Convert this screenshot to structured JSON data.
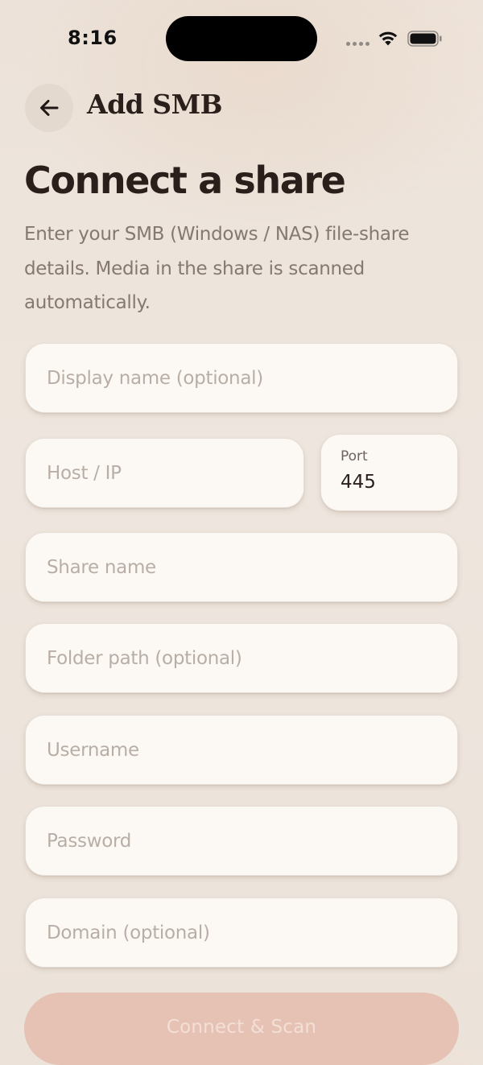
{
  "status_bar": {
    "time": "8:16",
    "icons": [
      "signal-dots-icon",
      "wifi-icon",
      "battery-icon"
    ]
  },
  "header": {
    "back_icon": "arrow-left-icon",
    "title": "Add SMB"
  },
  "main": {
    "title": "Connect a share",
    "description": "Enter your SMB (Windows / NAS) file-share details. Media in the share is scanned automatically."
  },
  "form": {
    "display_name": {
      "placeholder": "Display name (optional)",
      "value": ""
    },
    "host": {
      "placeholder": "Host / IP",
      "value": ""
    },
    "port": {
      "label": "Port",
      "value": "445"
    },
    "share_name": {
      "placeholder": "Share name",
      "value": ""
    },
    "folder_path": {
      "placeholder": "Folder path (optional)",
      "value": ""
    },
    "username": {
      "placeholder": "Username",
      "value": ""
    },
    "password": {
      "placeholder": "Password",
      "value": ""
    },
    "domain": {
      "placeholder": "Domain (optional)",
      "value": ""
    }
  },
  "actions": {
    "connect_label": "Connect & Scan"
  },
  "colors": {
    "background": "#ede4dc",
    "field_background": "#fcf9f5",
    "accent_disabled": "#e6c2b4",
    "title_text": "#2a1f1a",
    "secondary_text": "#85786f"
  }
}
